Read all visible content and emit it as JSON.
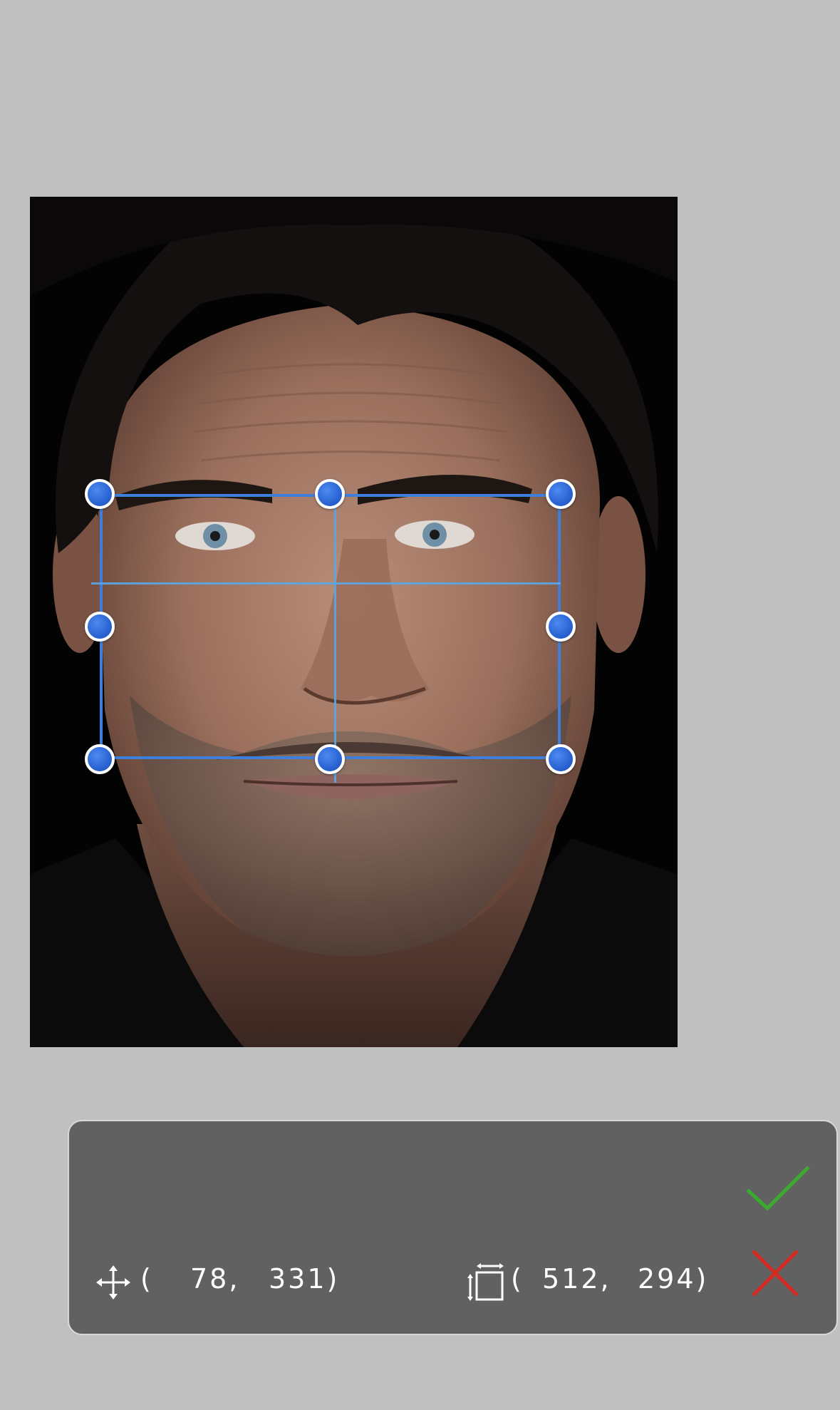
{
  "photo": {
    "description_icon": "face-photo"
  },
  "selection": {
    "handle_count": 8,
    "accent_color": "#3f7fdc",
    "guide_color": "#5aa7e6"
  },
  "panel": {
    "position": {
      "x": "78,",
      "y": "331)",
      "open": "("
    },
    "size": {
      "w": "512,",
      "h": "294)",
      "open": "("
    },
    "confirm_icon": "checkmark-icon",
    "cancel_icon": "x-icon",
    "confirm_color": "#3aab2e",
    "cancel_color": "#d52a21"
  }
}
